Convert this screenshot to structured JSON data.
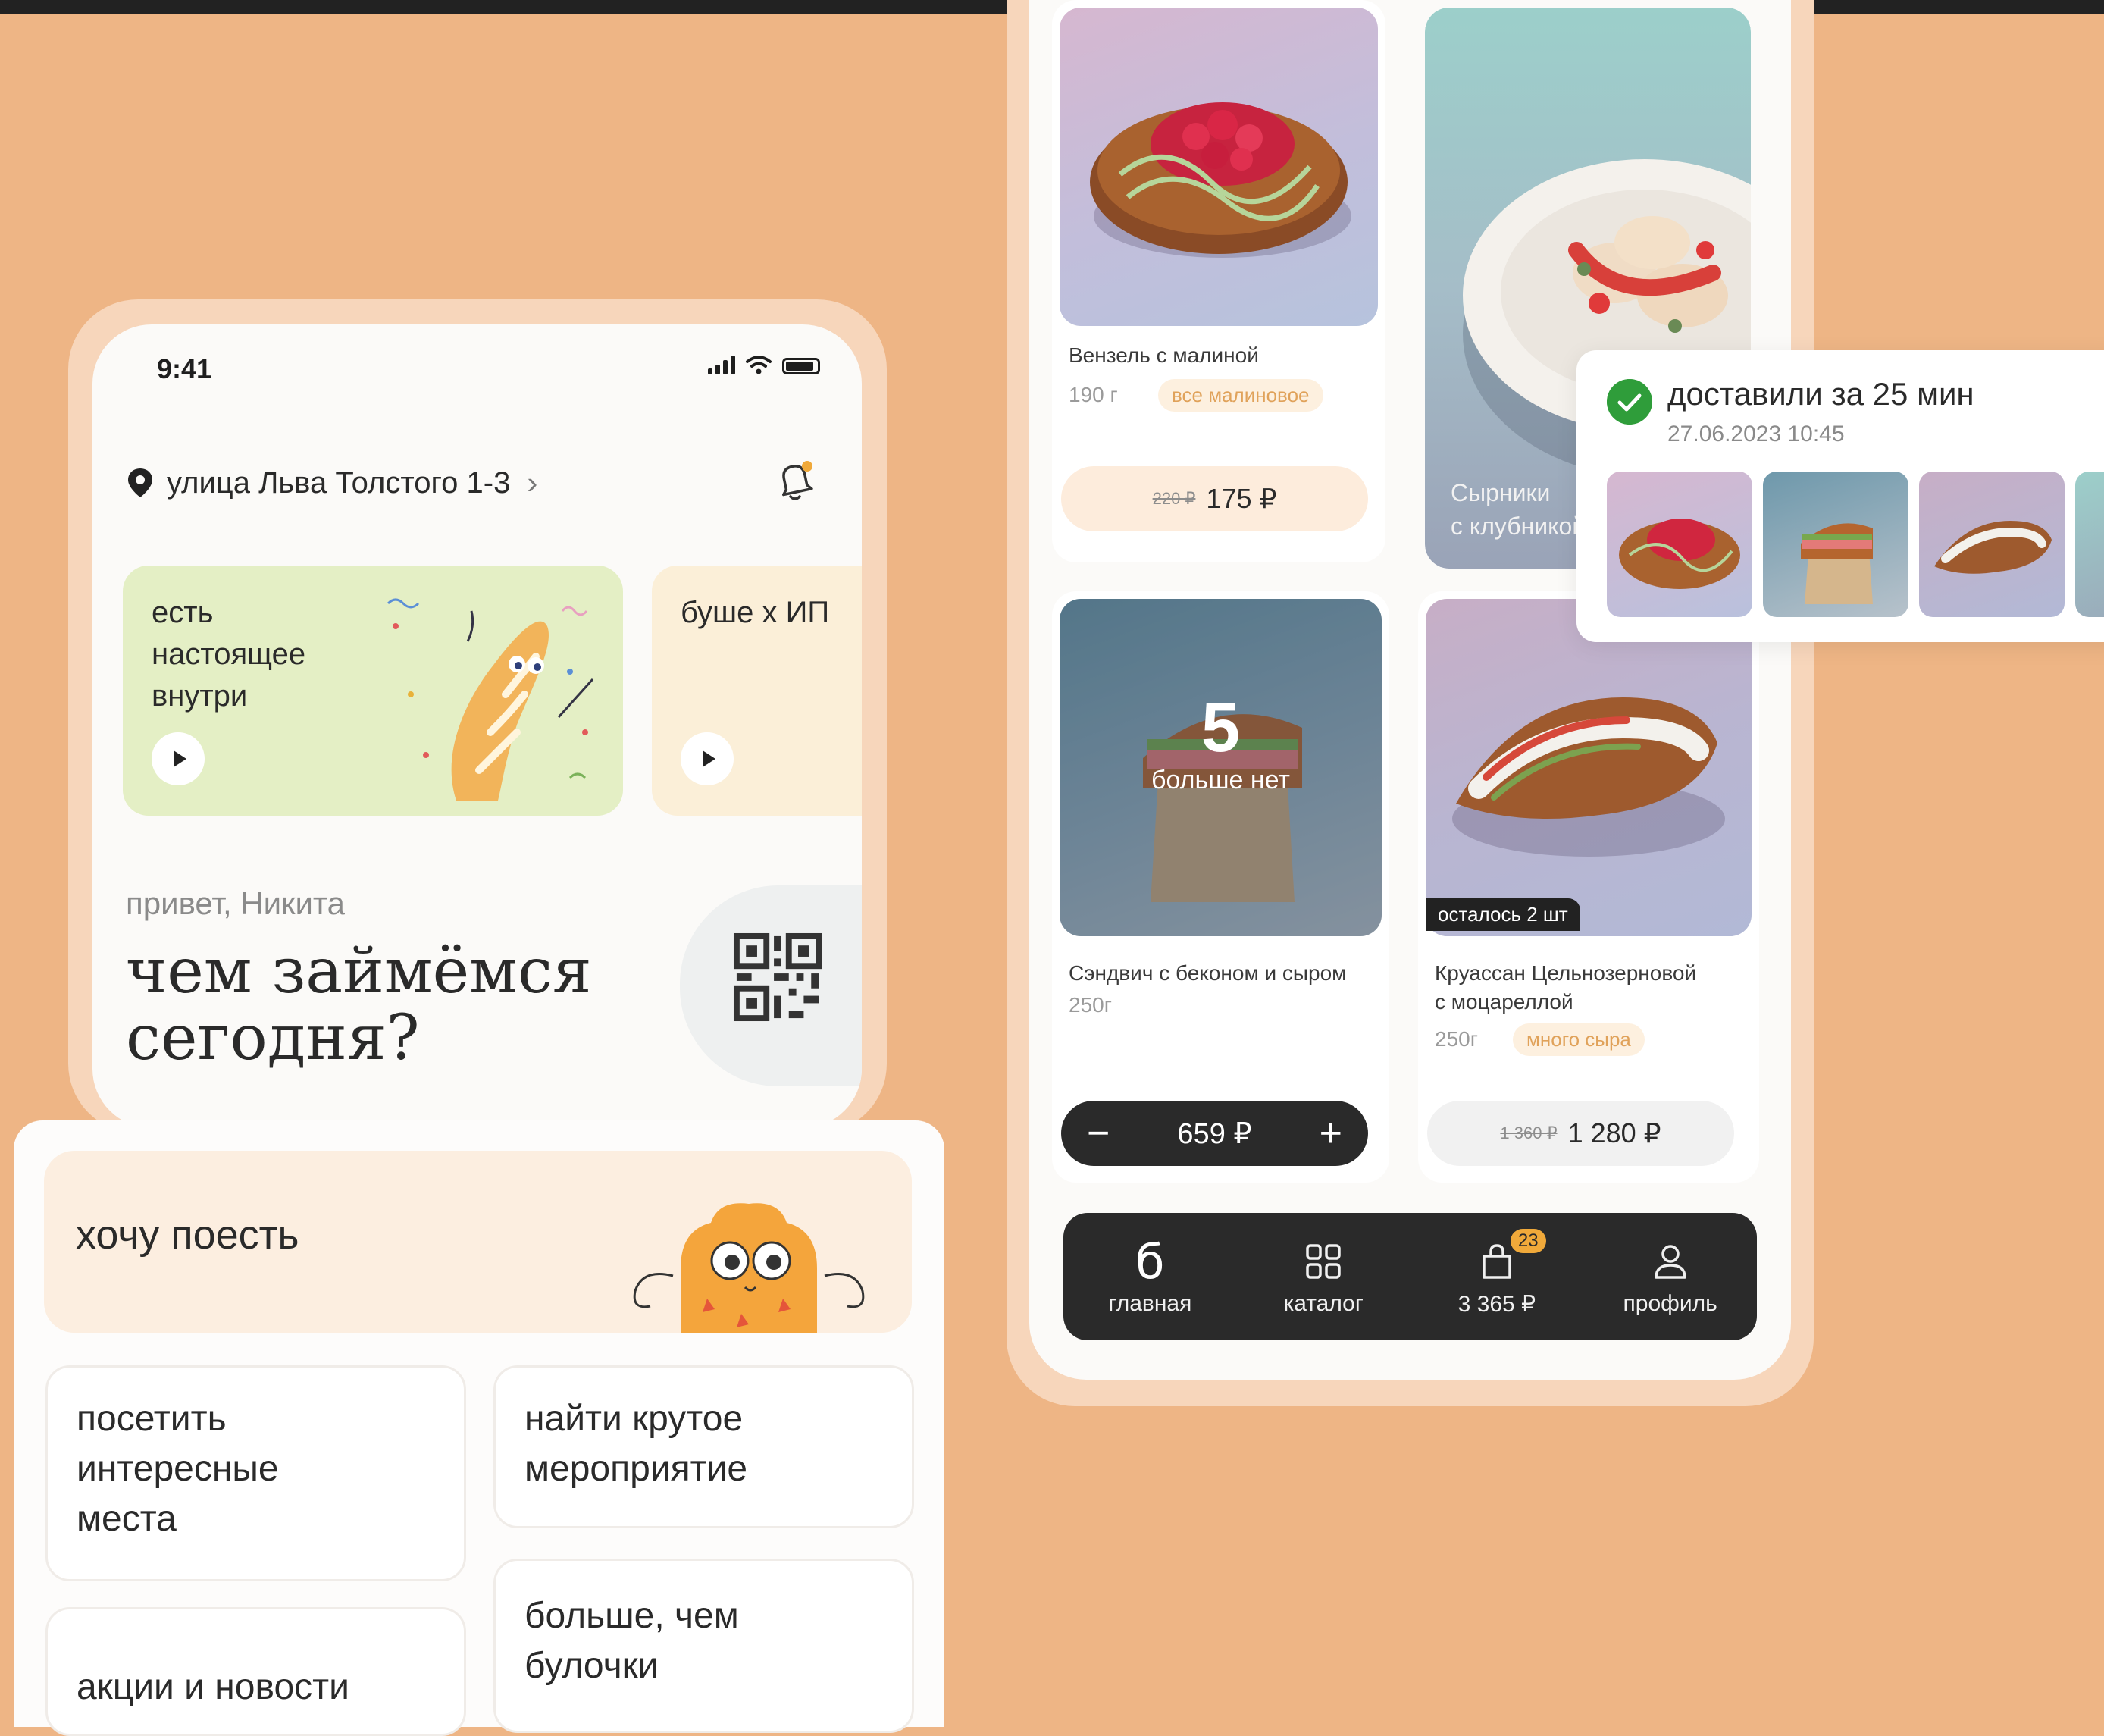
{
  "left_phone": {
    "time": "9:41",
    "address": "улица Льва Толстого 1-3",
    "stories": [
      {
        "text": "есть\nнастоящее\nвнутри"
      },
      {
        "text": "буше х ИП"
      }
    ],
    "greeting": "привет, Никита",
    "headline": "чем займёмся\nсегодня?"
  },
  "panel": {
    "want_eat": "хочу поесть",
    "options": [
      "посетить\nинтересные\nместа",
      "найти крутое\nмероприятие",
      "акции и новости",
      "больше, чем\nбулочки"
    ]
  },
  "products": [
    {
      "name": "Вензель с малиной",
      "weight": "190 г",
      "tag": "все малиновое",
      "old_price": "220 ₽",
      "price": "175 ₽"
    },
    {
      "name": "Сырники\nс клубникой"
    },
    {
      "name": "Сэндвич с беконом и сыром",
      "weight": "250г",
      "soldout_number": "5",
      "soldout_text": "больше нет",
      "price": "659 ₽",
      "minus": "−",
      "plus": "+"
    },
    {
      "name": "Круассан Цельнозерновой\nс моцареллой",
      "weight": "250г",
      "tag": "много сыра",
      "badge": "осталось 2 шт",
      "old_price": "1 360 ₽",
      "price": "1 280 ₽"
    }
  ],
  "tabbar": {
    "items": [
      {
        "icon": "logo-b-icon",
        "glyph": "б",
        "label": "главная"
      },
      {
        "icon": "catalog-grid-icon",
        "label": "каталог"
      },
      {
        "icon": "shopping-bag-icon",
        "label": "3 365 ₽",
        "badge": "23"
      },
      {
        "icon": "profile-user-icon",
        "label": "профиль"
      }
    ]
  },
  "delivery": {
    "title": "доставили за 25 мин",
    "date": "27.06.2023 10:45"
  },
  "colors": {
    "background": "#eeb585",
    "accent_orange": "#f0a93a",
    "success_green": "#2f9d3a",
    "dark": "#2a2a2a"
  }
}
